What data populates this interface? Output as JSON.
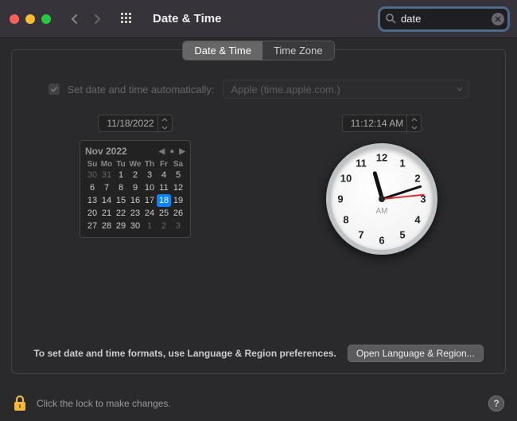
{
  "window": {
    "title": "Date & Time"
  },
  "search": {
    "value": "date"
  },
  "tabs": {
    "date_time": "Date & Time",
    "time_zone": "Time Zone"
  },
  "auto": {
    "label": "Set date and time automatically:",
    "server": "Apple (time.apple.com.)"
  },
  "datefield": "11/18/2022",
  "timefield": "11:12:14 AM",
  "calendar": {
    "month_year": "Nov 2022",
    "dow": [
      "Su",
      "Mo",
      "Tu",
      "We",
      "Th",
      "Fr",
      "Sa"
    ],
    "weeks": [
      [
        {
          "d": "30",
          "dim": true
        },
        {
          "d": "31",
          "dim": true
        },
        {
          "d": "1"
        },
        {
          "d": "2"
        },
        {
          "d": "3"
        },
        {
          "d": "4"
        },
        {
          "d": "5"
        }
      ],
      [
        {
          "d": "6"
        },
        {
          "d": "7"
        },
        {
          "d": "8"
        },
        {
          "d": "9"
        },
        {
          "d": "10"
        },
        {
          "d": "11"
        },
        {
          "d": "12"
        }
      ],
      [
        {
          "d": "13"
        },
        {
          "d": "14"
        },
        {
          "d": "15"
        },
        {
          "d": "16"
        },
        {
          "d": "17"
        },
        {
          "d": "18",
          "today": true
        },
        {
          "d": "19"
        }
      ],
      [
        {
          "d": "20"
        },
        {
          "d": "21"
        },
        {
          "d": "22"
        },
        {
          "d": "23"
        },
        {
          "d": "24"
        },
        {
          "d": "25"
        },
        {
          "d": "26"
        }
      ],
      [
        {
          "d": "27"
        },
        {
          "d": "28"
        },
        {
          "d": "29"
        },
        {
          "d": "30"
        },
        {
          "d": "1",
          "dim": true
        },
        {
          "d": "2",
          "dim": true
        },
        {
          "d": "3",
          "dim": true
        }
      ]
    ]
  },
  "clock": {
    "ampm": "AM",
    "numbers": [
      "12",
      "1",
      "2",
      "3",
      "4",
      "5",
      "6",
      "7",
      "8",
      "9",
      "10",
      "11"
    ],
    "hour_angle": -16,
    "minute_angle": 72,
    "second_angle": 84
  },
  "hint": "To set date and time formats, use Language & Region preferences.",
  "open_btn": "Open Language & Region...",
  "lock_text": "Click the lock to make changes.",
  "help": "?"
}
